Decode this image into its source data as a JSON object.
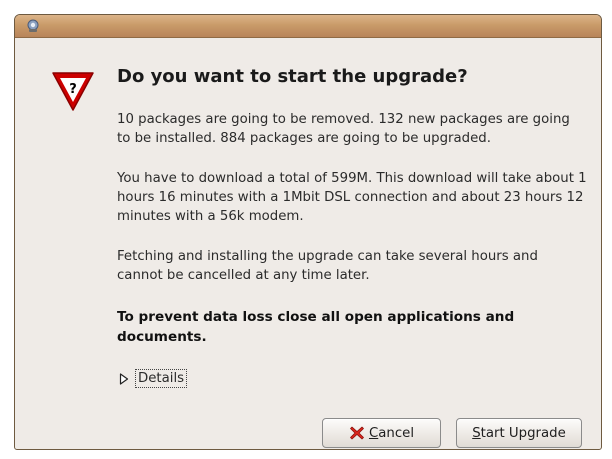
{
  "window": {
    "titlebar_icon": "upgrade-app-icon"
  },
  "dialog": {
    "icon": "warning-question-icon",
    "heading": "Do you want to start the upgrade?",
    "paragraphs": [
      "10 packages are going to be removed. 132 new packages are going to be installed. 884 packages are going to be upgraded.",
      "You have to download a total of 599M. This download will take about 1 hours 16 minutes with a 1Mbit DSL connection and about 23 hours 12 minutes with a 56k modem.",
      "Fetching and installing the upgrade can take several hours and cannot be cancelled at any time later.",
      "To prevent data loss close all open applications and documents."
    ],
    "details": {
      "label": "Details",
      "icon": "expander-collapsed-icon"
    }
  },
  "buttons": {
    "cancel": {
      "mnemonic": "C",
      "rest": "ancel",
      "icon": "cancel-icon"
    },
    "start": {
      "mnemonic": "S",
      "rest": "tart Upgrade"
    }
  },
  "colors": {
    "titlebar": "#c99b69",
    "window_bg": "#efebe7",
    "warning_red": "#cc0000"
  }
}
